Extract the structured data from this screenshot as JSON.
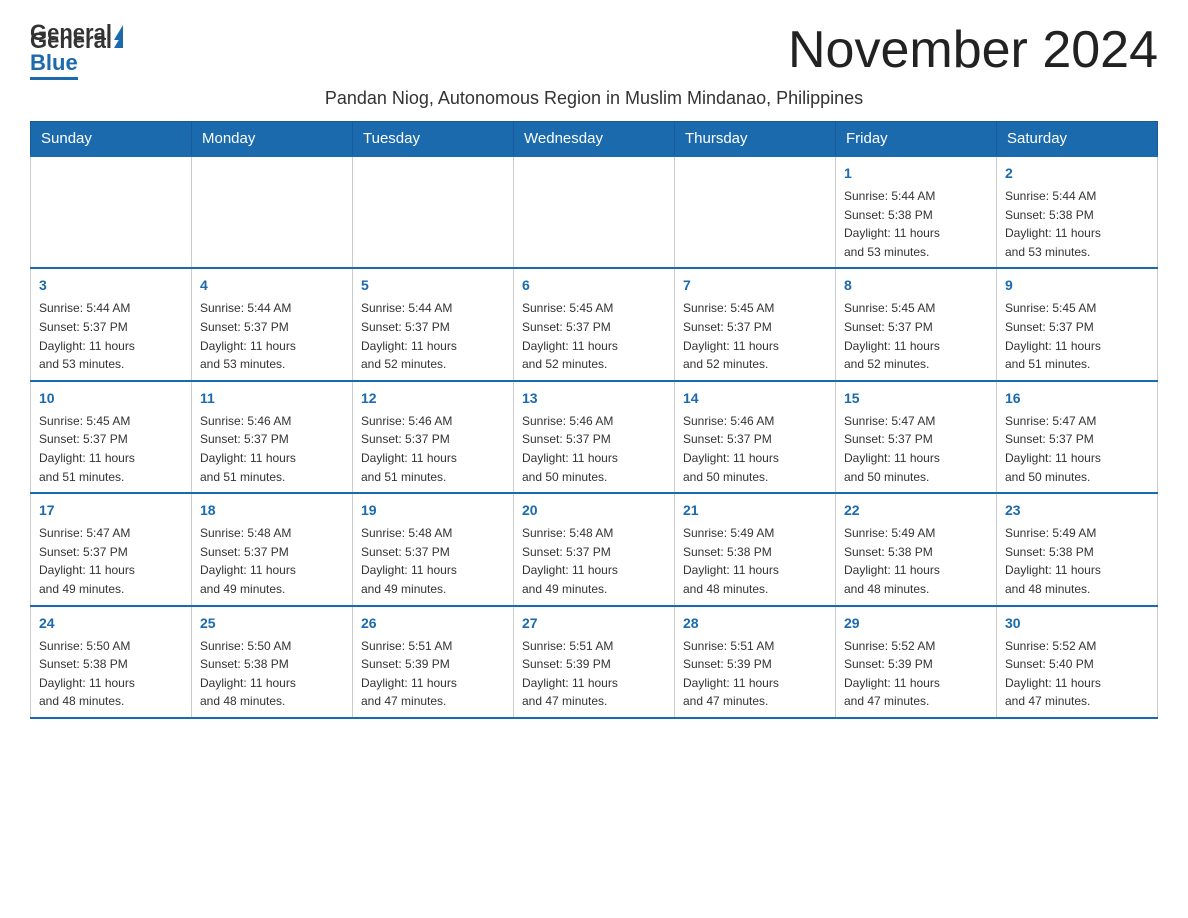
{
  "header": {
    "logo_general": "General",
    "logo_blue": "Blue",
    "month_title": "November 2024",
    "subtitle": "Pandan Niog, Autonomous Region in Muslim Mindanao, Philippines"
  },
  "days_of_week": [
    "Sunday",
    "Monday",
    "Tuesday",
    "Wednesday",
    "Thursday",
    "Friday",
    "Saturday"
  ],
  "weeks": [
    [
      {
        "day": "",
        "info": ""
      },
      {
        "day": "",
        "info": ""
      },
      {
        "day": "",
        "info": ""
      },
      {
        "day": "",
        "info": ""
      },
      {
        "day": "",
        "info": ""
      },
      {
        "day": "1",
        "info": "Sunrise: 5:44 AM\nSunset: 5:38 PM\nDaylight: 11 hours\nand 53 minutes."
      },
      {
        "day": "2",
        "info": "Sunrise: 5:44 AM\nSunset: 5:38 PM\nDaylight: 11 hours\nand 53 minutes."
      }
    ],
    [
      {
        "day": "3",
        "info": "Sunrise: 5:44 AM\nSunset: 5:37 PM\nDaylight: 11 hours\nand 53 minutes."
      },
      {
        "day": "4",
        "info": "Sunrise: 5:44 AM\nSunset: 5:37 PM\nDaylight: 11 hours\nand 53 minutes."
      },
      {
        "day": "5",
        "info": "Sunrise: 5:44 AM\nSunset: 5:37 PM\nDaylight: 11 hours\nand 52 minutes."
      },
      {
        "day": "6",
        "info": "Sunrise: 5:45 AM\nSunset: 5:37 PM\nDaylight: 11 hours\nand 52 minutes."
      },
      {
        "day": "7",
        "info": "Sunrise: 5:45 AM\nSunset: 5:37 PM\nDaylight: 11 hours\nand 52 minutes."
      },
      {
        "day": "8",
        "info": "Sunrise: 5:45 AM\nSunset: 5:37 PM\nDaylight: 11 hours\nand 52 minutes."
      },
      {
        "day": "9",
        "info": "Sunrise: 5:45 AM\nSunset: 5:37 PM\nDaylight: 11 hours\nand 51 minutes."
      }
    ],
    [
      {
        "day": "10",
        "info": "Sunrise: 5:45 AM\nSunset: 5:37 PM\nDaylight: 11 hours\nand 51 minutes."
      },
      {
        "day": "11",
        "info": "Sunrise: 5:46 AM\nSunset: 5:37 PM\nDaylight: 11 hours\nand 51 minutes."
      },
      {
        "day": "12",
        "info": "Sunrise: 5:46 AM\nSunset: 5:37 PM\nDaylight: 11 hours\nand 51 minutes."
      },
      {
        "day": "13",
        "info": "Sunrise: 5:46 AM\nSunset: 5:37 PM\nDaylight: 11 hours\nand 50 minutes."
      },
      {
        "day": "14",
        "info": "Sunrise: 5:46 AM\nSunset: 5:37 PM\nDaylight: 11 hours\nand 50 minutes."
      },
      {
        "day": "15",
        "info": "Sunrise: 5:47 AM\nSunset: 5:37 PM\nDaylight: 11 hours\nand 50 minutes."
      },
      {
        "day": "16",
        "info": "Sunrise: 5:47 AM\nSunset: 5:37 PM\nDaylight: 11 hours\nand 50 minutes."
      }
    ],
    [
      {
        "day": "17",
        "info": "Sunrise: 5:47 AM\nSunset: 5:37 PM\nDaylight: 11 hours\nand 49 minutes."
      },
      {
        "day": "18",
        "info": "Sunrise: 5:48 AM\nSunset: 5:37 PM\nDaylight: 11 hours\nand 49 minutes."
      },
      {
        "day": "19",
        "info": "Sunrise: 5:48 AM\nSunset: 5:37 PM\nDaylight: 11 hours\nand 49 minutes."
      },
      {
        "day": "20",
        "info": "Sunrise: 5:48 AM\nSunset: 5:37 PM\nDaylight: 11 hours\nand 49 minutes."
      },
      {
        "day": "21",
        "info": "Sunrise: 5:49 AM\nSunset: 5:38 PM\nDaylight: 11 hours\nand 48 minutes."
      },
      {
        "day": "22",
        "info": "Sunrise: 5:49 AM\nSunset: 5:38 PM\nDaylight: 11 hours\nand 48 minutes."
      },
      {
        "day": "23",
        "info": "Sunrise: 5:49 AM\nSunset: 5:38 PM\nDaylight: 11 hours\nand 48 minutes."
      }
    ],
    [
      {
        "day": "24",
        "info": "Sunrise: 5:50 AM\nSunset: 5:38 PM\nDaylight: 11 hours\nand 48 minutes."
      },
      {
        "day": "25",
        "info": "Sunrise: 5:50 AM\nSunset: 5:38 PM\nDaylight: 11 hours\nand 48 minutes."
      },
      {
        "day": "26",
        "info": "Sunrise: 5:51 AM\nSunset: 5:39 PM\nDaylight: 11 hours\nand 47 minutes."
      },
      {
        "day": "27",
        "info": "Sunrise: 5:51 AM\nSunset: 5:39 PM\nDaylight: 11 hours\nand 47 minutes."
      },
      {
        "day": "28",
        "info": "Sunrise: 5:51 AM\nSunset: 5:39 PM\nDaylight: 11 hours\nand 47 minutes."
      },
      {
        "day": "29",
        "info": "Sunrise: 5:52 AM\nSunset: 5:39 PM\nDaylight: 11 hours\nand 47 minutes."
      },
      {
        "day": "30",
        "info": "Sunrise: 5:52 AM\nSunset: 5:40 PM\nDaylight: 11 hours\nand 47 minutes."
      }
    ]
  ]
}
